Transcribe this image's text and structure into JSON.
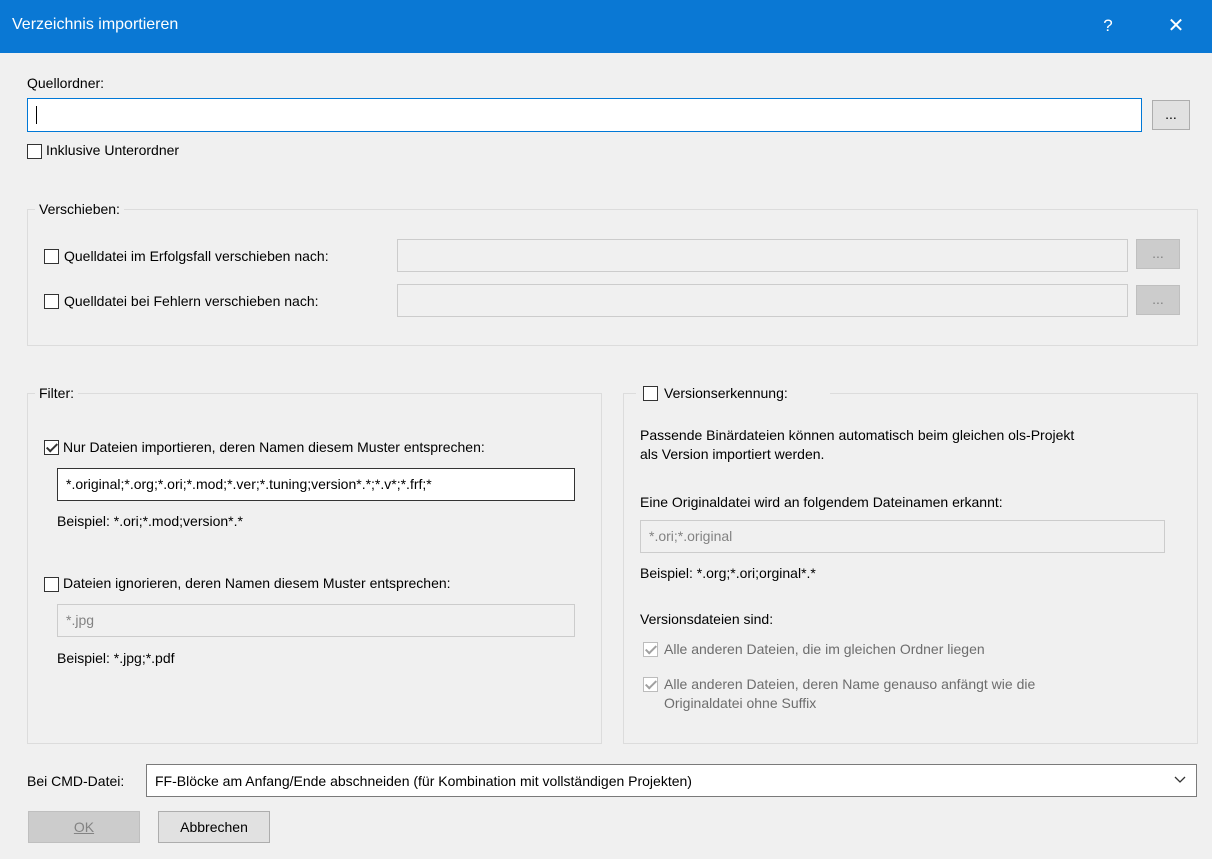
{
  "window": {
    "title": "Verzeichnis importieren",
    "help_label": "?",
    "close_label": "✕"
  },
  "source": {
    "label": "Quellordner:",
    "value": "",
    "browse_label": "...",
    "include_subfolders_label": "Inklusive Unterordner",
    "include_subfolders_checked": false
  },
  "move": {
    "legend": "Verschieben:",
    "on_success_label": "Quelldatei im Erfolgsfall verschieben nach:",
    "on_success_checked": false,
    "on_success_value": "",
    "on_error_label": "Quelldatei bei Fehlern verschieben nach:",
    "on_error_checked": false,
    "on_error_value": "",
    "browse_label": "..."
  },
  "filter": {
    "legend": "Filter:",
    "include_label": "Nur Dateien importieren, deren Namen diesem Muster entsprechen:",
    "include_checked": true,
    "include_value": "*.original;*.org;*.ori;*.mod;*.ver;*.tuning;version*.*;*.v*;*.frf;*",
    "include_example": "Beispiel: *.ori;*.mod;version*.*",
    "ignore_label": "Dateien ignorieren, deren Namen diesem Muster entsprechen:",
    "ignore_checked": false,
    "ignore_value": "*.jpg",
    "ignore_example": "Beispiel: *.jpg;*.pdf"
  },
  "version": {
    "legend": "Versionserkennung:",
    "enabled": false,
    "description_line1": "Passende Binärdateien können automatisch beim gleichen ols-Projekt",
    "description_line2": "als Version importiert werden.",
    "original_label": "Eine Originaldatei wird an folgendem Dateinamen erkannt:",
    "original_value": "*.ori;*.original",
    "original_example": "Beispiel: *.org;*.ori;orginal*.*",
    "version_files_label": "Versionsdateien sind:",
    "option1_label": "Alle anderen Dateien, die im gleichen Ordner liegen",
    "option1_checked": true,
    "option2_line1": "Alle anderen Dateien, deren Name genauso anfängt wie die",
    "option2_line2": "Originaldatei ohne Suffix",
    "option2_checked": true
  },
  "cmd": {
    "label": "Bei CMD-Datei:",
    "selected": "FF-Blöcke am Anfang/Ende abschneiden (für Kombination mit vollständigen Projekten)"
  },
  "buttons": {
    "ok_label": "OK",
    "cancel_label": "Abbrechen"
  }
}
